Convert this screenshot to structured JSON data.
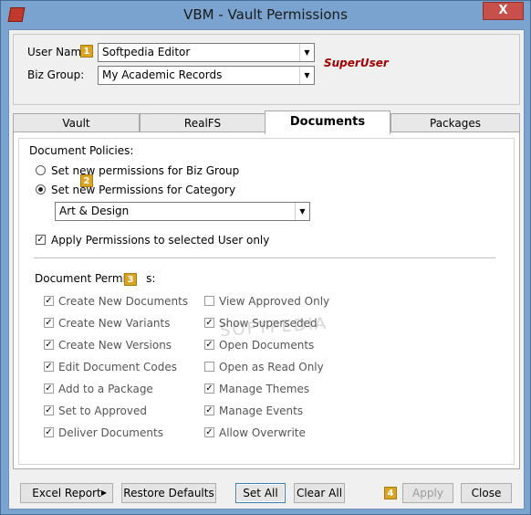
{
  "window": {
    "title": "VBM - Vault Permissions",
    "close_glyph": "X"
  },
  "header": {
    "user_name_label": "User Nam",
    "user_name_value": "Softpedia Editor",
    "biz_group_label": "Biz Group:",
    "biz_group_value": "My Academic Records",
    "role": "SuperUser"
  },
  "badges": {
    "b1": "1",
    "b2": "2",
    "b3": "3",
    "b4": "4"
  },
  "tabs": [
    {
      "label": "Vault"
    },
    {
      "label": "RealFS"
    },
    {
      "label": "Documents",
      "active": true
    },
    {
      "label": "Packages"
    }
  ],
  "policies": {
    "heading": "Document Policies:",
    "option1": "Set new permissions for Biz Group",
    "option2": "Set new Permissions for Category",
    "category_value": "Art & Design",
    "apply_selected_user": "Apply Permissions to selected User only",
    "selected_option": 2
  },
  "permissions": {
    "heading_a": "Document Permis",
    "heading_b": "s:",
    "left": [
      {
        "label": "Create New Documents",
        "checked": true
      },
      {
        "label": "Create New Variants",
        "checked": true
      },
      {
        "label": "Create New Versions",
        "checked": true
      },
      {
        "label": "Edit Document Codes",
        "checked": true
      },
      {
        "label": "Add to a Package",
        "checked": true
      },
      {
        "label": "Set to Approved",
        "checked": true
      },
      {
        "label": "Deliver Documents",
        "checked": true
      }
    ],
    "right": [
      {
        "label": "View Approved Only",
        "checked": false
      },
      {
        "label": "Show Superseded",
        "checked": true
      },
      {
        "label": "Open Documents",
        "checked": true
      },
      {
        "label": "Open as Read Only",
        "checked": false
      },
      {
        "label": "Manage Themes",
        "checked": true
      },
      {
        "label": "Manage Events",
        "checked": true
      },
      {
        "label": "Allow Overwrite",
        "checked": true
      }
    ]
  },
  "watermark": "SOFTPEDIA",
  "buttons": {
    "excel_report": "Excel Report",
    "restore_defaults": "Restore Defaults",
    "set_all": "Set All",
    "clear_all": "Clear All",
    "apply": "Apply",
    "close": "Close"
  }
}
